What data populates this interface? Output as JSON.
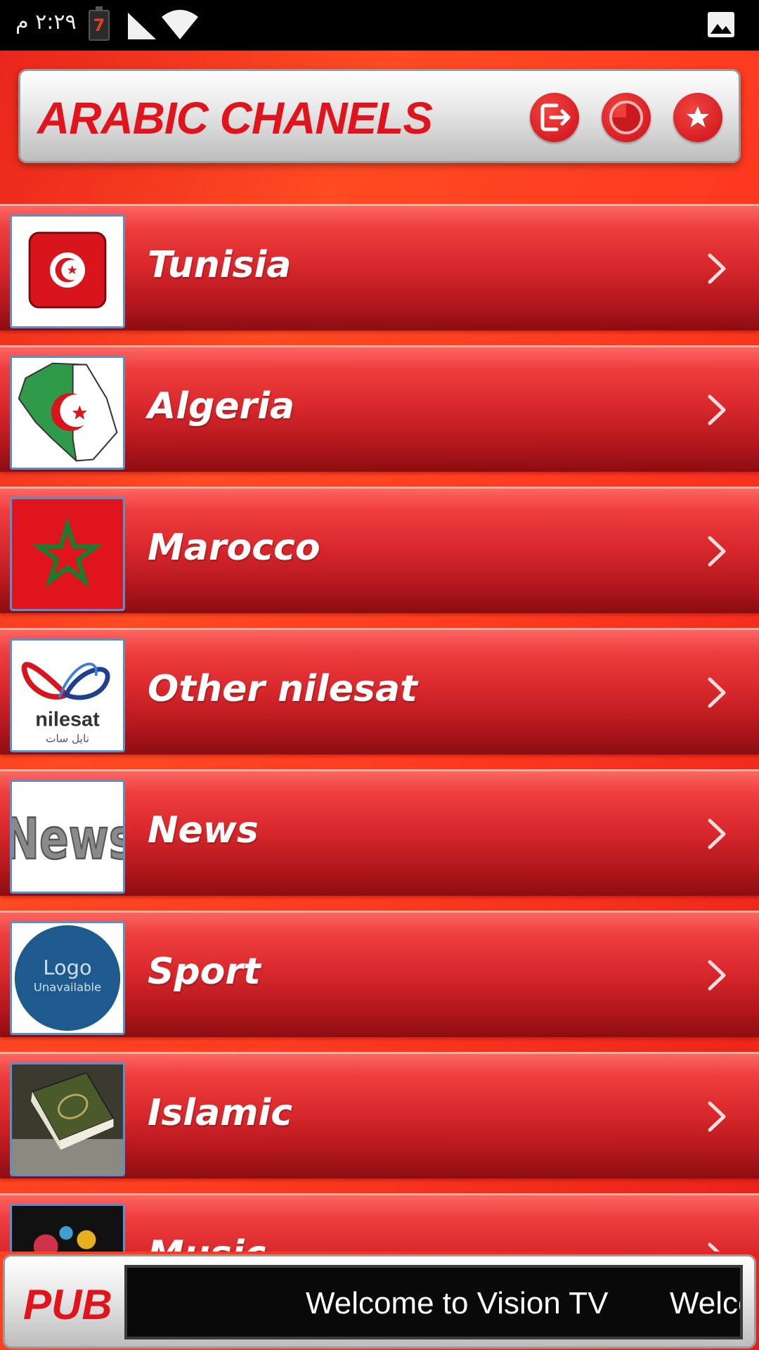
{
  "status_bar": {
    "time": "٢:٢٩ م",
    "battery_level": "7",
    "icons": [
      "battery-icon",
      "signal-icon",
      "wifi-icon",
      "gallery-icon"
    ]
  },
  "header": {
    "title": "ARABIC CHANELS",
    "buttons": [
      {
        "name": "exit-button",
        "icon": "exit-icon"
      },
      {
        "name": "history-button",
        "icon": "clock-icon"
      },
      {
        "name": "favorites-button",
        "icon": "star-icon"
      }
    ]
  },
  "channels": [
    {
      "label": "Tunisia",
      "thumb": "tunisia-flag"
    },
    {
      "label": "Algeria",
      "thumb": "algeria-map-flag"
    },
    {
      "label": "Marocco",
      "thumb": "morocco-flag"
    },
    {
      "label": "Other nilesat",
      "thumb": "nilesat-logo"
    },
    {
      "label": "News",
      "thumb": "news-logo"
    },
    {
      "label": "Sport",
      "thumb": "logo-unavailable"
    },
    {
      "label": "Islamic",
      "thumb": "quran-book"
    },
    {
      "label": "Music",
      "thumb": "music-logo"
    }
  ],
  "thumb_text": {
    "nilesat": "nilesat",
    "nilesat_arabic": "نايل سات",
    "news": "News",
    "logo": "Logo",
    "unavailable": "Unavailable"
  },
  "ad": {
    "label": "PUB",
    "ticker": "Welcome to Vision TV",
    "ticker_repeat": "Welcome to Vision TV"
  },
  "colors": {
    "accent_red": "#e0141c",
    "background_orange_red": "#ff3b20",
    "row_top": "#fb6661",
    "row_bottom": "#8c0d11",
    "thumb_border": "#5b8fc9"
  }
}
